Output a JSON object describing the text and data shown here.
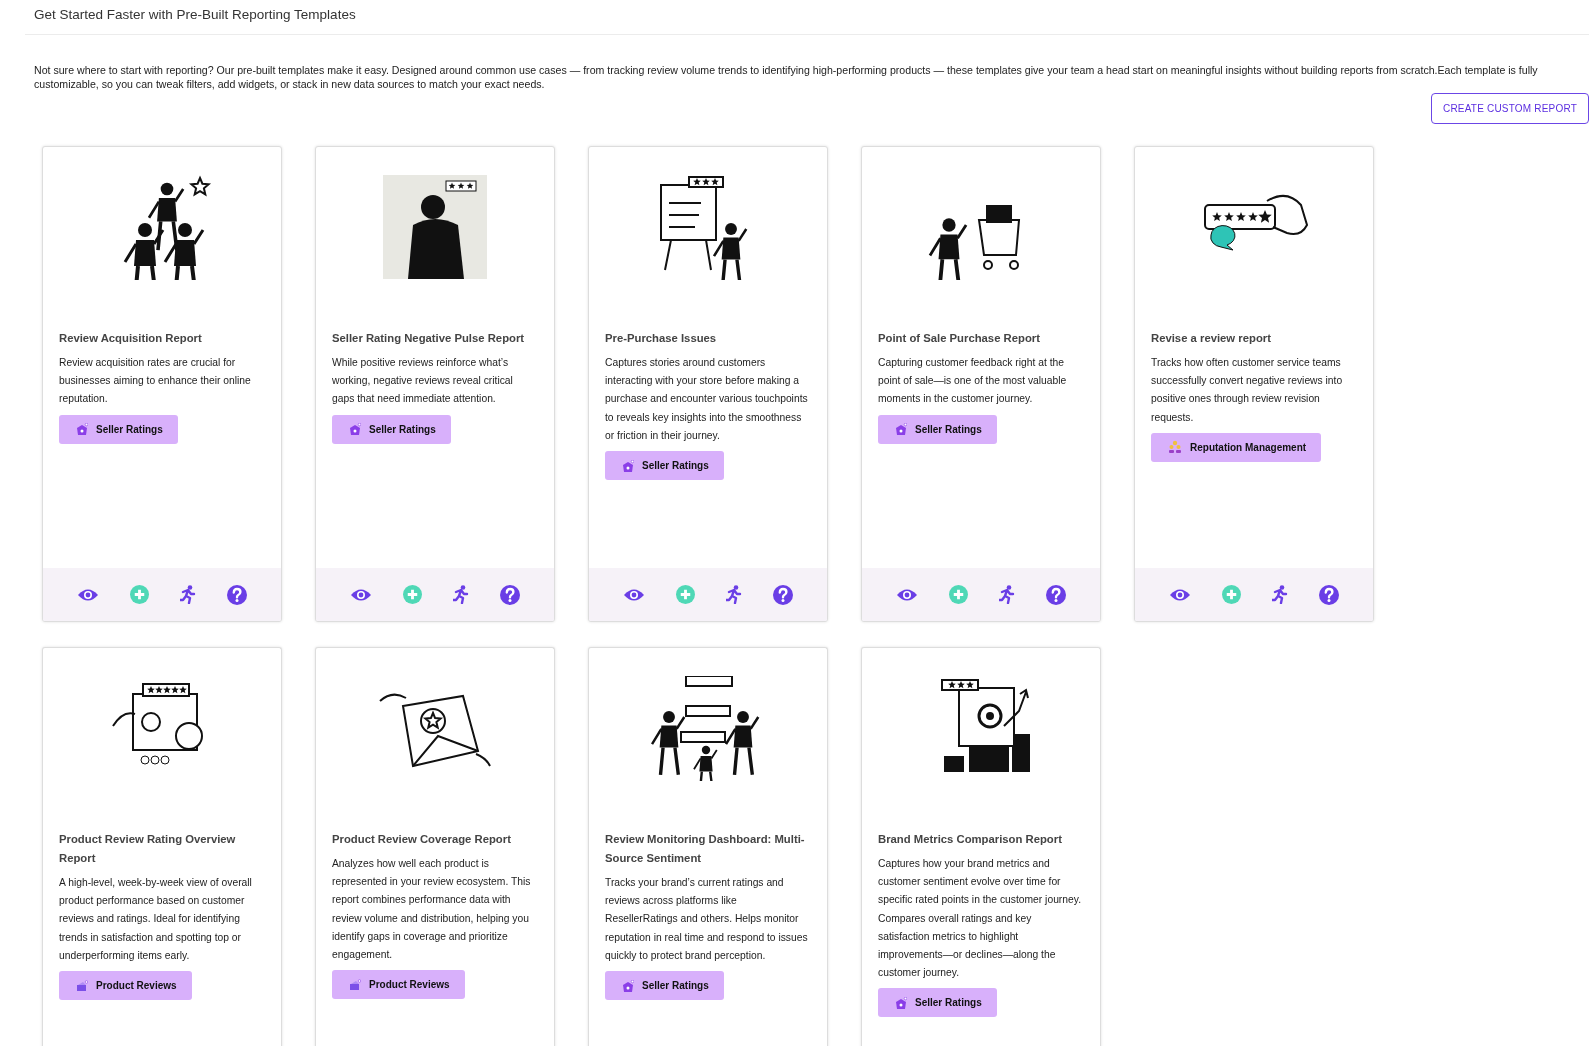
{
  "header": {
    "title": "Get Started Faster with Pre-Built Reporting Templates",
    "intro": "Not sure where to start with reporting? Our pre-built templates make it easy. Designed around common use cases — from tracking review volume trends to identifying high-performing products — these templates give your team a head start on meaningful insights without building reports from scratch.Each template is fully customizable, so you can tweak filters, add widgets, or stack in new data sources to match your exact needs.",
    "action": "CREATE CUSTOM REPORT"
  },
  "templates": [
    {
      "title": "Review Acquisition Report",
      "description": "Review acquisition rates are crucial for businesses aiming to enhance their online reputation.",
      "tag": {
        "label": "Seller Ratings",
        "kind": "ratings"
      },
      "actions": [
        {
          "kind": "view"
        },
        {
          "kind": "add"
        },
        {
          "kind": "run"
        },
        {
          "kind": "help"
        }
      ]
    },
    {
      "title": "Seller Rating Negative Pulse Report",
      "description": "While positive reviews reinforce what’s working, negative reviews reveal critical gaps that need immediate attention.",
      "tag": {
        "label": "Seller Ratings",
        "kind": "ratings"
      },
      "actions": [
        {
          "kind": "view"
        },
        {
          "kind": "add"
        },
        {
          "kind": "run"
        },
        {
          "kind": "help"
        }
      ]
    },
    {
      "title": "Pre-Purchase Issues",
      "description": "Captures stories around customers interacting with your store before making a purchase and encounter various touchpoints to reveals key insights into the smoothness or friction in their journey.",
      "tag": {
        "label": "Seller Ratings",
        "kind": "ratings"
      },
      "actions": [
        {
          "kind": "view"
        },
        {
          "kind": "add"
        },
        {
          "kind": "run"
        },
        {
          "kind": "help"
        }
      ]
    },
    {
      "title": "Point of Sale Purchase Report",
      "description": "Capturing customer feedback right at the point of sale—is one of the most valuable moments in the customer journey.",
      "tag": {
        "label": "Seller Ratings",
        "kind": "ratings"
      },
      "actions": [
        {
          "kind": "view"
        },
        {
          "kind": "add"
        },
        {
          "kind": "run"
        },
        {
          "kind": "help"
        }
      ]
    },
    {
      "title": "Revise a review report",
      "description": "Tracks how often customer service teams successfully convert negative reviews into positive ones through review revision requests.",
      "tag": {
        "label": "Reputation Management",
        "kind": "reputation"
      },
      "actions": [
        {
          "kind": "view"
        },
        {
          "kind": "add"
        },
        {
          "kind": "run"
        },
        {
          "kind": "help"
        }
      ]
    },
    {
      "title": "Product Review Rating Overview Report",
      "description": "A high-level, week-by-week view of overall product performance based on customer reviews and ratings. Ideal for identifying trends in satisfaction and spotting top or underperforming items early.",
      "tag": {
        "label": "Product Reviews",
        "kind": "products"
      }
    },
    {
      "title": "Product Review Coverage Report",
      "description": "Analyzes how well each product is represented in your review ecosystem. This report combines performance data with review volume and distribution, helping you identify gaps in coverage and prioritize engagement.",
      "tag": {
        "label": "Product Reviews",
        "kind": "products"
      }
    },
    {
      "title": "Review Monitoring Dashboard: Multi-Source Sentiment",
      "description": "Tracks your brand’s current ratings and reviews across platforms like ResellerRatings and others. Helps monitor reputation in real time and respond to issues quickly to protect brand perception.",
      "tag": {
        "label": "Seller Ratings",
        "kind": "ratings"
      }
    },
    {
      "title": "Brand Metrics Comparison Report",
      "description": "Captures how your brand metrics and customer sentiment evolve over time for specific rated points in the customer journey. Compares overall ratings and key satisfaction metrics to highlight improvements—or declines—along the customer journey.",
      "tag": {
        "label": "Seller Ratings",
        "kind": "ratings"
      }
    }
  ]
}
